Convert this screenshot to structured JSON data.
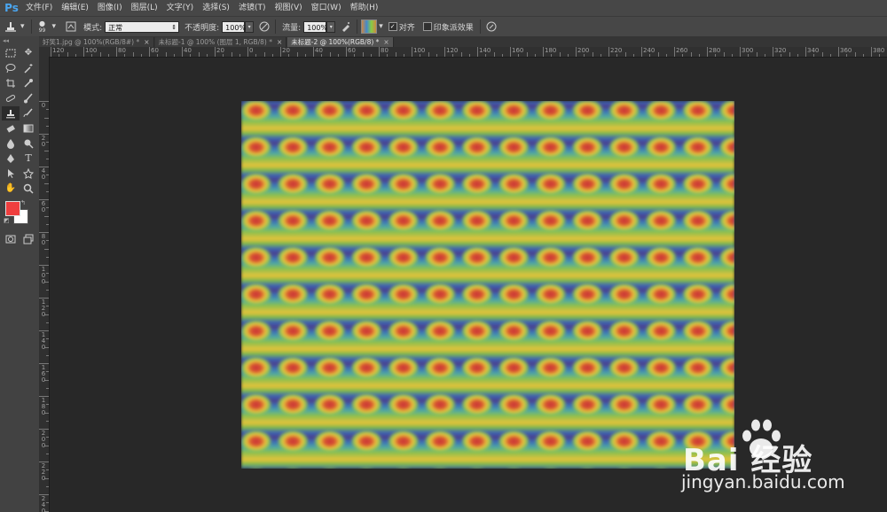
{
  "app": {
    "logo": "Ps"
  },
  "menu": [
    "文件(F)",
    "编辑(E)",
    "图像(I)",
    "图层(L)",
    "文字(Y)",
    "选择(S)",
    "滤镜(T)",
    "视图(V)",
    "窗口(W)",
    "帮助(H)"
  ],
  "options": {
    "brush_size": "99",
    "mode_label": "模式:",
    "mode_value": "正常",
    "opacity_label": "不透明度:",
    "opacity_value": "100%",
    "flow_label": "流量:",
    "flow_value": "100%",
    "aligned_label": "对齐",
    "aligned_checked": true,
    "impressionist_label": "印象派效果",
    "impressionist_checked": false
  },
  "tabs": [
    {
      "label": "好笑1.jpg @ 100%(RGB/8#) *",
      "active": false
    },
    {
      "label": "未标题-1 @ 100% (图层 1, RGB/8) *",
      "active": false
    },
    {
      "label": "未标题-2 @ 100%(RGB/8) *",
      "active": true
    }
  ],
  "ruler_h_labels": [
    "120",
    "100",
    "80",
    "60",
    "40",
    "20",
    "0",
    "20",
    "40",
    "60",
    "80",
    "100",
    "120",
    "140",
    "160",
    "180",
    "200",
    "220",
    "240",
    "260",
    "280",
    "300",
    "320",
    "340",
    "360",
    "380"
  ],
  "ruler_v_labels": [
    "0",
    "2 0",
    "4 0",
    "6 0",
    "8 0",
    "1 0 0",
    "1 2 0",
    "1 4 0",
    "1 6 0",
    "1 8 0",
    "2 0 0",
    "2 2 0",
    "2 4 0"
  ],
  "colors": {
    "foreground": "#ef3e3e",
    "background": "#ffffff"
  },
  "watermark": {
    "brand": "Bai 经验",
    "url": "jingyan.baidu.com"
  }
}
